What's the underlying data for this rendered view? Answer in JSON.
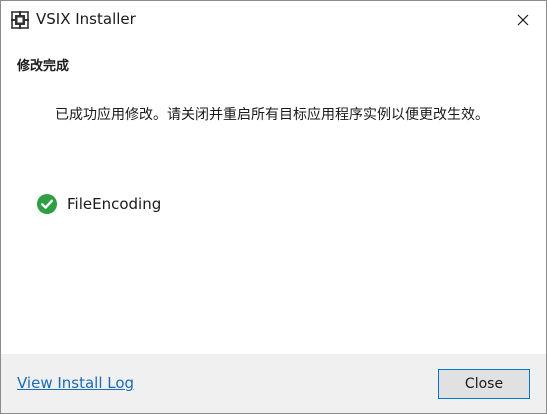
{
  "window": {
    "title": "VSIX Installer",
    "title_icon": "vsix-installer-icon",
    "close_icon": "close-icon"
  },
  "content": {
    "heading": "修改完成",
    "message": "已成功应用修改。请关闭并重启所有目标应用程序实例以便更改生效。",
    "extension": {
      "name": "FileEncoding",
      "status_icon": "check-circle-icon",
      "status_color": "#2ea043"
    }
  },
  "footer": {
    "log_link": "View Install Log",
    "close_button": "Close"
  },
  "colors": {
    "link": "#1a6bb8",
    "button_border": "#0078d7",
    "footer_bg": "#f0f0f0"
  }
}
